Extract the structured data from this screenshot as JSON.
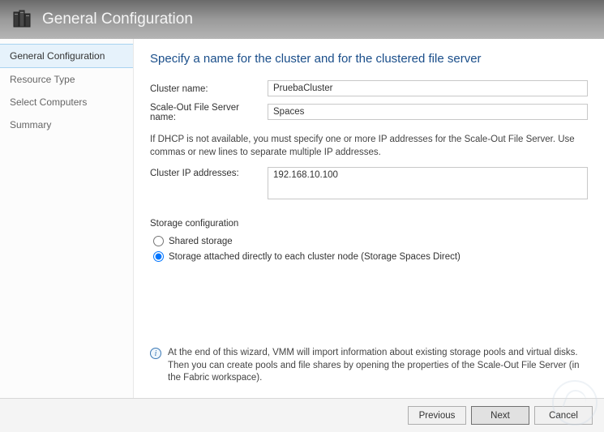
{
  "header": {
    "title": "General Configuration"
  },
  "sidebar": {
    "items": [
      {
        "label": "General Configuration",
        "active": true
      },
      {
        "label": "Resource Type",
        "active": false
      },
      {
        "label": "Select Computers",
        "active": false
      },
      {
        "label": "Summary",
        "active": false
      }
    ]
  },
  "main": {
    "heading": "Specify a name for the cluster and for the clustered file server",
    "cluster_name_label": "Cluster name:",
    "cluster_name_value": "PruebaCluster",
    "sofs_name_label": "Scale-Out File Server name:",
    "sofs_name_value": "Spaces",
    "dhcp_hint": "If DHCP is not available, you must specify one or more IP addresses for the Scale-Out File Server. Use commas or new lines to separate multiple IP addresses.",
    "cluster_ip_label": "Cluster IP addresses:",
    "cluster_ip_value": "192.168.10.100",
    "storage_section_label": "Storage configuration",
    "storage_options": [
      {
        "label": "Shared storage",
        "selected": false
      },
      {
        "label": "Storage attached directly to each cluster node (Storage Spaces Direct)",
        "selected": true
      }
    ],
    "info_text": "At the end of this wizard, VMM will import information about existing storage pools and virtual disks. Then you can create pools and file shares by opening the properties of the Scale-Out File Server (in the Fabric workspace)."
  },
  "footer": {
    "previous": "Previous",
    "next": "Next",
    "cancel": "Cancel"
  }
}
